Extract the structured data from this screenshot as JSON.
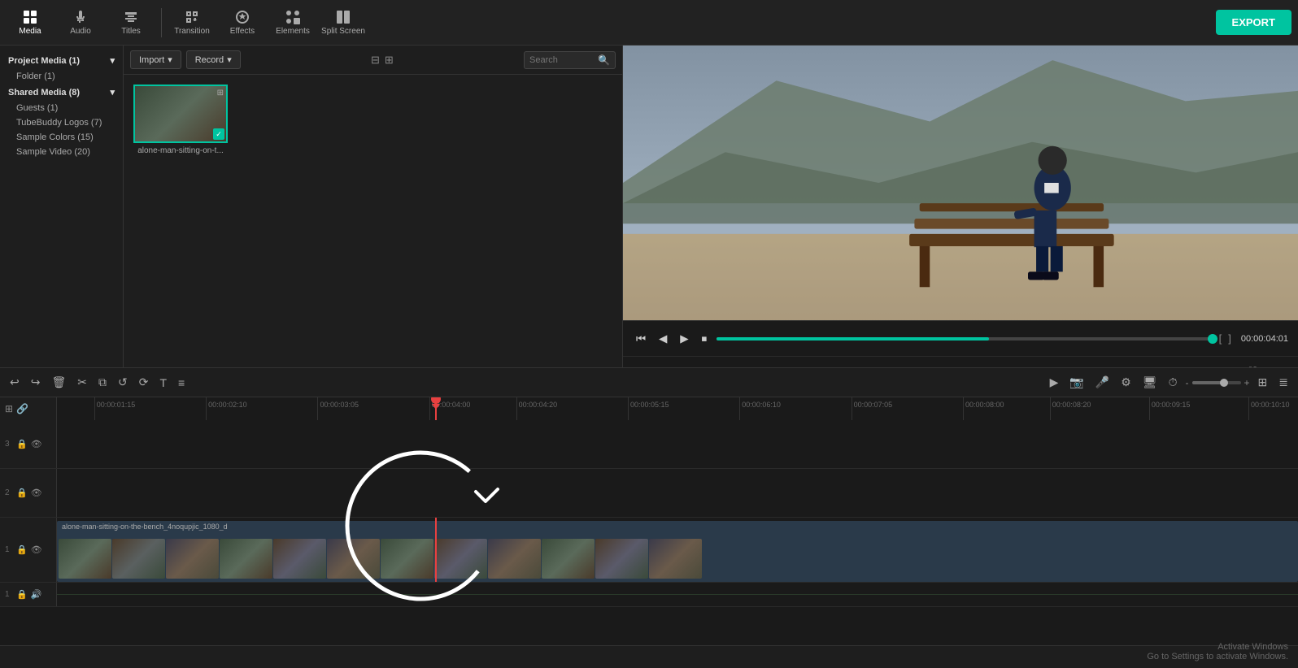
{
  "toolbar": {
    "export_label": "EXPORT",
    "tabs": [
      {
        "id": "media",
        "label": "Media",
        "icon": "grid"
      },
      {
        "id": "audio",
        "label": "Audio",
        "icon": "music"
      },
      {
        "id": "titles",
        "label": "Titles",
        "icon": "text"
      },
      {
        "id": "transition",
        "label": "Transition",
        "icon": "transition"
      },
      {
        "id": "effects",
        "label": "Effects",
        "icon": "effects"
      },
      {
        "id": "elements",
        "label": "Elements",
        "icon": "elements"
      },
      {
        "id": "splitscreen",
        "label": "Split Screen",
        "icon": "splitscreen"
      }
    ]
  },
  "sidebar": {
    "project_media": "Project Media (1)",
    "folder": "Folder (1)",
    "shared_media": "Shared Media (8)",
    "guests": "Guests (1)",
    "tubebuddy": "TubeBuddy Logos (7)",
    "sample_colors": "Sample Colors (15)",
    "sample_video": "Sample Video (20)"
  },
  "media_panel": {
    "import_label": "Import",
    "record_label": "Record",
    "search_placeholder": "Search",
    "clip": {
      "filename": "alone-man-sitting-on-t...",
      "filename_full": "alone-man-sitting-on-the-bench_4noqupjic_1080_d"
    }
  },
  "preview": {
    "time_current": "00:00:04:01",
    "progress_percent": 55
  },
  "timeline": {
    "timecodes": [
      "00:00:01:15",
      "00:00:02:10",
      "00:00:03:05",
      "00:00:04:00",
      "00:00:04:20",
      "00:00:05:15",
      "00:00:06:10",
      "00:00:07:05",
      "00:00:08:00",
      "00:00:08:20",
      "00:00:09:15",
      "00:00:10:10"
    ],
    "tracks": [
      {
        "num": "3",
        "type": "video",
        "has_lock": true,
        "has_eye": true
      },
      {
        "num": "2",
        "type": "video",
        "has_lock": true,
        "has_eye": true
      },
      {
        "num": "1",
        "type": "video",
        "has_lock": true,
        "has_eye": true
      },
      {
        "num": "1",
        "type": "audio",
        "has_lock": true,
        "has_speaker": true
      }
    ],
    "clip_label": "alone-man-sitting-on-the-bench_4noqupjic_1080_d"
  },
  "activate_windows": {
    "line1": "Activate Windows",
    "line2": "Go to Settings to activate Windows."
  }
}
